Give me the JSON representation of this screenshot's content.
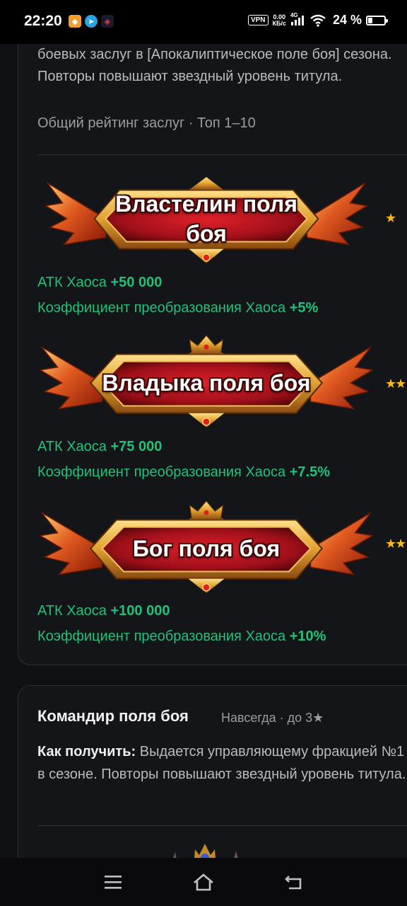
{
  "status_bar": {
    "time": "22:20",
    "vpn": "VPN",
    "net_speed_value": "0.00",
    "net_speed_unit": "КБ/с",
    "network": "4G",
    "battery": "24 %",
    "battery_level": 0.24
  },
  "card1": {
    "description": "боевых заслуг в [Апокалиптическое поле боя] сезона. Повторы повышают звездный уровень титула.",
    "rank": "Общий рейтинг заслуг · Топ 1–10",
    "tiers": [
      {
        "title": "Властелин поля боя",
        "stars": "★",
        "stat1_label": "АТК Хаоса",
        "stat1_value": "+50 000",
        "stat2_label": "Коэффициент преобразования Хаоса",
        "stat2_value": "+5%"
      },
      {
        "title": "Владыка поля боя",
        "stars": "★★",
        "stat1_label": "АТК Хаоса",
        "stat1_value": "+75 000",
        "stat2_label": "Коэффициент преобразования Хаоса",
        "stat2_value": "+7.5%"
      },
      {
        "title": "Бог поля боя",
        "stars": "★★",
        "stat1_label": "АТК Хаоса",
        "stat1_value": "+100 000",
        "stat2_label": "Коэффициент преобразования Хаоса",
        "stat2_value": "+10%"
      }
    ]
  },
  "card2": {
    "title": "Командир поля боя",
    "meta": "Навсегда · до 3★",
    "how_label": "Как получить:",
    "how_text": " Выдается управляющему фракцией №1 в сезоне. Повторы повышают звездный уровень титула."
  },
  "colors": {
    "accent_green": "#20c27a",
    "star": "#f5b820",
    "background": "#101114"
  },
  "nav": {
    "icons": [
      "menu-icon",
      "home-icon",
      "back-icon"
    ]
  }
}
